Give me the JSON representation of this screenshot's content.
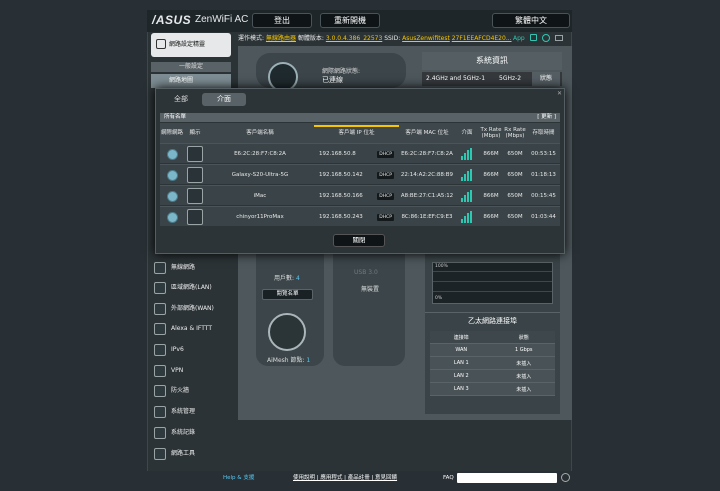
{
  "header": {
    "brand": "/ASUS",
    "product": "ZenWiFi AC",
    "logout": "登出",
    "reboot": "重新開機",
    "language": "繁體中文"
  },
  "status_bar": {
    "mode_label": "運作模式:",
    "mode_value": "無線路由器",
    "fw_label": "韌體版本:",
    "fw_value": "3.0.0.4.386_22573",
    "ssid_label": "SSID:",
    "ssid_value": "AsusZenwifitest",
    "ssid2": "27F1EEAFCD4E20...",
    "app": "App"
  },
  "sidebar": {
    "quick": "網路設定精靈",
    "general": "一般設定",
    "selected": "網路地圖",
    "items": [
      "無線網路",
      "區域網路(LAN)",
      "外部網路(WAN)",
      "Alexa & IFTTT",
      "IPv6",
      "VPN",
      "防火牆",
      "系統管理",
      "系統記錄",
      "網路工具"
    ]
  },
  "network": {
    "label": "網際網路狀態:",
    "status": "已連線"
  },
  "sysinfo": {
    "title": "系統資訊",
    "tab1": "2.4GHz and 5GHz-1",
    "tab2": "5GHz-2",
    "tab3": "狀態"
  },
  "modal": {
    "tab_all": "全部",
    "tab_iface": "介面",
    "list_title": "所有名單",
    "refresh": "[ 更新 ]",
    "columns": [
      "網際網路",
      "顯示",
      "客戶端名稱",
      "客戶端 IP 位址",
      "客戶端 MAC 位址",
      "介面",
      "Tx Rate (Mbps)",
      "Rx Rate (Mbps)",
      "存取時間"
    ],
    "rows": [
      {
        "name": "E6:2C:28:F7:C8:2A",
        "ip": "192.168.50.8",
        "dhcp": "DHCP",
        "mac": "E6:2C:28:F7:C8:2A",
        "tx": "866M",
        "rx": "650M",
        "time": "00:53:15"
      },
      {
        "name": "Galaxy-S20-Ultra-5G",
        "ip": "192.168.50.142",
        "dhcp": "DHCP",
        "mac": "22:14:A2:2C:88:B9",
        "tx": "866M",
        "rx": "650M",
        "time": "01:18:13"
      },
      {
        "name": "iMac",
        "ip": "192.168.50.166",
        "dhcp": "DHCP",
        "mac": "A8:BE:27:C1:A5:12",
        "tx": "866M",
        "rx": "650M",
        "time": "00:15:45"
      },
      {
        "name": "chinyor11ProMax",
        "ip": "192.168.50.243",
        "dhcp": "DHCP",
        "mac": "8C:86:1E:EF:C9:E3",
        "tx": "866M",
        "rx": "650M",
        "time": "01:03:44"
      }
    ],
    "close": "關閉"
  },
  "clients": {
    "count_label": "用戶數:",
    "count": "4",
    "view_list": "閱覽名單"
  },
  "usb": {
    "label": "USB 3.0",
    "status": "無裝置"
  },
  "aimesh": {
    "label": "AiMesh 節點:",
    "count": "1"
  },
  "graph": {
    "top": "100%",
    "bottom": "0%"
  },
  "ethernet": {
    "title": "乙太網路連接埠",
    "col1": "連接埠",
    "col2": "狀態",
    "rows": [
      {
        "port": "WAN",
        "status": "1 Gbps"
      },
      {
        "port": "LAN 1",
        "status": "未插入"
      },
      {
        "port": "LAN 2",
        "status": "未插入"
      },
      {
        "port": "LAN 3",
        "status": "未插入"
      }
    ]
  },
  "footer": {
    "help": "Help & 支援",
    "links": "使用說明 | 應用程式 | 產品註冊 | 意見回饋",
    "faq": "FAQ"
  },
  "colors": {
    "accent": "#f6c600",
    "signal": "#2fc7b2",
    "link": "#5bc6ef"
  }
}
